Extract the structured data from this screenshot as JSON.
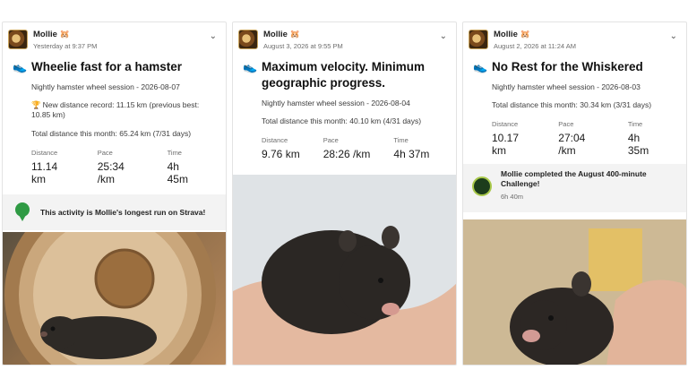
{
  "cards": [
    {
      "user": "Mollie",
      "when": "Yesterday at 9:37 PM",
      "title": "Wheelie fast for a hamster",
      "subtitle": "Nightly hamster wheel session - 2026-08-07",
      "record": "New distance record: 11.15 km (previous best: 10.85 km)",
      "total": "Total distance this month: 65.24 km (7/31 days)",
      "stats": [
        {
          "label": "Distance",
          "value": "11.14 km"
        },
        {
          "label": "Pace",
          "value": "25:34 /km"
        },
        {
          "label": "Time",
          "value": "4h 45m"
        }
      ],
      "banner": "This activity is Mollie's longest run on Strava!"
    },
    {
      "user": "Mollie",
      "when": "August 3, 2026 at 9:55 PM",
      "title": "Maximum velocity. Minimum geographic progress.",
      "subtitle": "Nightly hamster wheel session - 2026-08-04",
      "total": "Total distance this month: 40.10 km (4/31 days)",
      "stats": [
        {
          "label": "Distance",
          "value": "9.76 km"
        },
        {
          "label": "Pace",
          "value": "28:26 /km"
        },
        {
          "label": "Time",
          "value": "4h 37m"
        }
      ]
    },
    {
      "user": "Mollie",
      "when": "August 2, 2026 at 11:24 AM",
      "title": "No Rest for the Whiskered",
      "subtitle": "Nightly hamster wheel session - 2026-08-03",
      "total": "Total distance this month: 30.34 km (3/31 days)",
      "stats": [
        {
          "label": "Distance",
          "value": "10.17 km"
        },
        {
          "label": "Pace",
          "value": "27:04 /km"
        },
        {
          "label": "Time",
          "value": "4h 35m"
        }
      ],
      "challenge": "Mollie completed the August 400-minute Challenge!",
      "challenge_time": "6h 40m"
    }
  ],
  "icons": {
    "emoji": "hamster-face-icon",
    "activity": "shoe-icon",
    "record": "trophy-icon",
    "banner": "ribbon-award-icon",
    "challenge": "challenge-badge-icon",
    "menu": "chevron-down-icon"
  },
  "colors": {
    "accent_green": "#2f9a44",
    "trophy_gold": "#d7a11a"
  }
}
